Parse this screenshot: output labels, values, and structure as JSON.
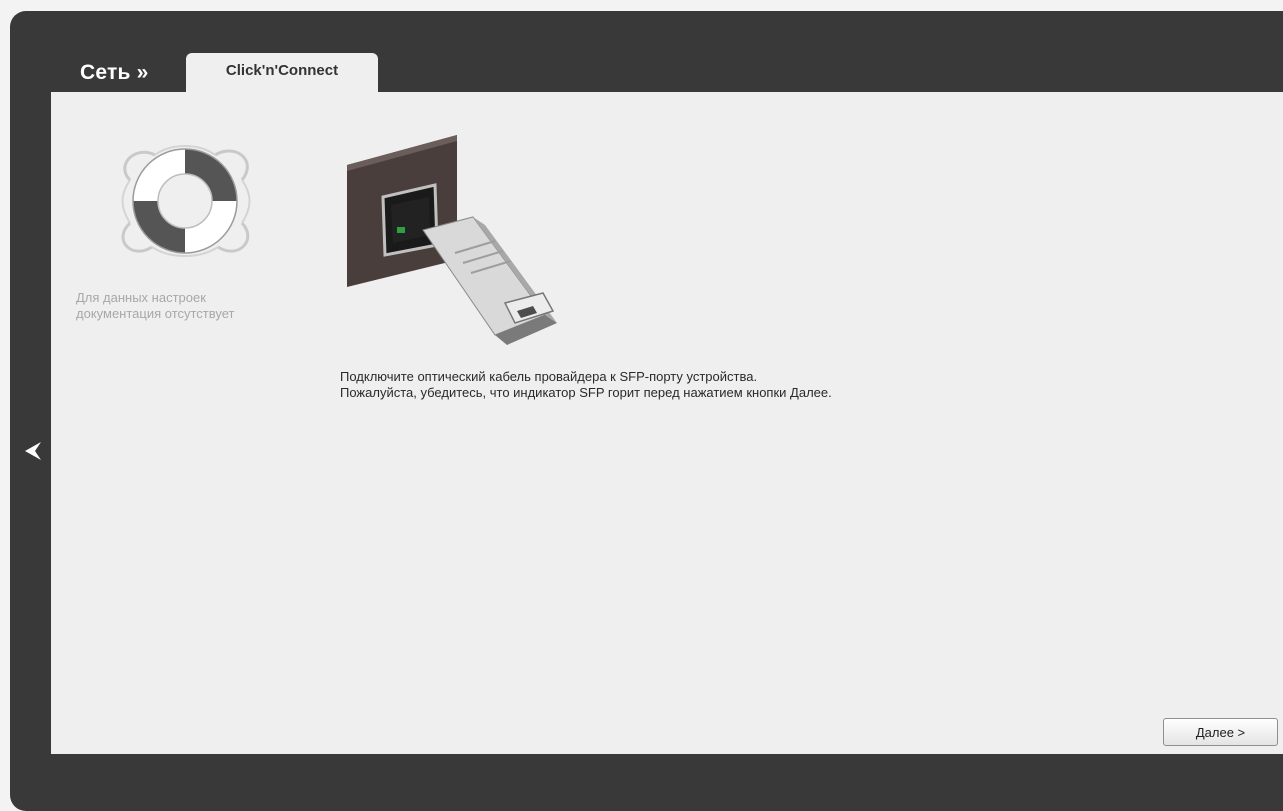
{
  "header": {
    "title": "Сеть »",
    "tab_label": "Click'n'Connect"
  },
  "help": {
    "icon": "lifebuoy-icon",
    "text_line1": "Для данных настроек",
    "text_line2": "документация отсутствует"
  },
  "main": {
    "image": "sfp-module-illustration",
    "instruction_line1": "Подключите оптический кабель провайдера к SFP-порту устройства.",
    "instruction_line2": "Пожалуйста, убедитесь, что индикатор SFP горит перед нажатием кнопки Далее."
  },
  "navigation": {
    "back_icon": "chevron-left-icon",
    "next_label": "Далее >"
  },
  "colors": {
    "frame": "#393939",
    "panel": "#efefef",
    "help_text": "#a8a8a8"
  }
}
